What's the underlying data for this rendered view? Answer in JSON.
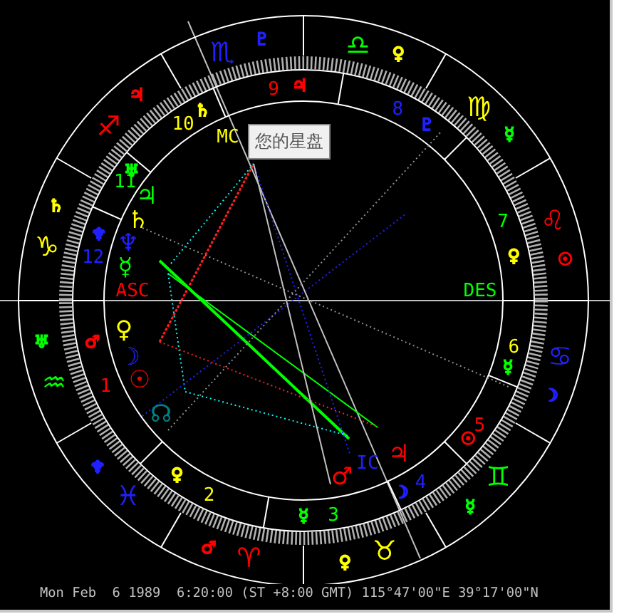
{
  "signs": [
    {
      "symbol": "♈",
      "color": "#ff0000",
      "ruler": {
        "symbol": "♂",
        "color": "#ff0000"
      }
    },
    {
      "symbol": "♉",
      "color": "#ffff00",
      "ruler": {
        "symbol": "♀",
        "color": "#ffff00"
      }
    },
    {
      "symbol": "♊",
      "color": "#00ff00",
      "ruler": {
        "symbol": "☿",
        "color": "#00ff00"
      }
    },
    {
      "symbol": "♋",
      "color": "#2020ff",
      "ruler": {
        "symbol": "☽",
        "color": "#2020ff"
      }
    },
    {
      "symbol": "♌",
      "color": "#ff0000",
      "ruler": {
        "symbol": "☉",
        "color": "#ff0000"
      }
    },
    {
      "symbol": "♍",
      "color": "#ffff00",
      "ruler": {
        "symbol": "☿",
        "color": "#00ff00"
      }
    },
    {
      "symbol": "♎",
      "color": "#00ff00",
      "ruler": {
        "symbol": "♀",
        "color": "#ffff00"
      }
    },
    {
      "symbol": "♏",
      "color": "#2020ff",
      "ruler": {
        "symbol": "♇",
        "color": "#2020ff"
      }
    },
    {
      "symbol": "♐",
      "color": "#ff0000",
      "ruler": {
        "symbol": "♃",
        "color": "#ff0000"
      }
    },
    {
      "symbol": "♑",
      "color": "#ffff00",
      "ruler": {
        "symbol": "♄",
        "color": "#ffff00"
      }
    },
    {
      "symbol": "♒",
      "color": "#00ff00",
      "ruler": {
        "symbol": "♅",
        "color": "#00ff00"
      }
    },
    {
      "symbol": "♓",
      "color": "#2020ff",
      "ruler": {
        "symbol": "♆",
        "color": "#2020ff"
      }
    }
  ],
  "houses": [
    {
      "number": "1",
      "color": "#ff0000",
      "ruler": {
        "symbol": "♂",
        "color": "#ff0000"
      }
    },
    {
      "number": "2",
      "color": "#ffff00",
      "ruler": {
        "symbol": "♀",
        "color": "#ffff00"
      }
    },
    {
      "number": "3",
      "color": "#00ff00",
      "ruler": {
        "symbol": "☿",
        "color": "#00ff00"
      }
    },
    {
      "number": "4",
      "color": "#2020ff",
      "ruler": {
        "symbol": "☽",
        "color": "#2020ff"
      }
    },
    {
      "number": "5",
      "color": "#ff0000",
      "ruler": {
        "symbol": "☉",
        "color": "#ff0000"
      }
    },
    {
      "number": "6",
      "color": "#ffff00",
      "ruler": {
        "symbol": "☿",
        "color": "#00ff00"
      }
    },
    {
      "number": "7",
      "color": "#00ff00",
      "ruler": {
        "symbol": "♀",
        "color": "#ffff00"
      }
    },
    {
      "number": "8",
      "color": "#2020ff",
      "ruler": {
        "symbol": "♇",
        "color": "#2020ff"
      }
    },
    {
      "number": "9",
      "color": "#ff0000",
      "ruler": {
        "symbol": "♃",
        "color": "#ff0000"
      }
    },
    {
      "number": "10",
      "color": "#ffff00",
      "ruler": {
        "symbol": "♄",
        "color": "#ffff00"
      }
    },
    {
      "number": "11",
      "color": "#00ff00",
      "ruler": {
        "symbol": "♅",
        "color": "#00ff00"
      }
    },
    {
      "number": "12",
      "color": "#2020ff",
      "ruler": {
        "symbol": "♆",
        "color": "#2020ff"
      }
    }
  ],
  "planets": [
    {
      "symbol": "♃",
      "color": "#00ff00"
    },
    {
      "symbol": "♄",
      "color": "#ffff00"
    },
    {
      "symbol": "♆",
      "color": "#2020ff"
    },
    {
      "symbol": "☿",
      "color": "#00ff00"
    },
    {
      "symbol": "♀",
      "color": "#ffff00"
    },
    {
      "symbol": "☽",
      "color": "#2020ff"
    },
    {
      "symbol": "☉",
      "color": "#ff0000"
    },
    {
      "symbol": "☊",
      "color": "#008080"
    },
    {
      "symbol": "♂",
      "color": "#ff0000"
    },
    {
      "symbol": "♃",
      "color": "#ff0000"
    }
  ],
  "angles": [
    {
      "label": "MC",
      "color": "#ffff00"
    },
    {
      "label": "ASC",
      "color": "#ff0000"
    },
    {
      "label": "DES",
      "color": "#00ff00"
    },
    {
      "label": "IC",
      "color": "#2020ff"
    }
  ],
  "tooltip": "您的星盘",
  "status_bar": "Mon Feb  6 1989  6:20:00 (ST +8:00 GMT) 115°47'00\"E 39°17'00\"N"
}
